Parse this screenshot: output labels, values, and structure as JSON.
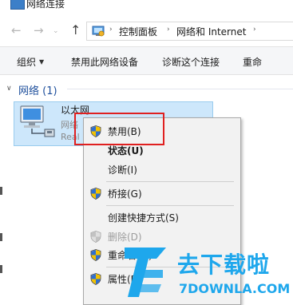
{
  "window": {
    "title": "网络连接"
  },
  "nav": {
    "back_label": "←",
    "forward_label": "→",
    "dropdown_label": "⌄",
    "up_label": "↑"
  },
  "address": {
    "crumbs": [
      "控制面板",
      "网络和 Internet"
    ],
    "separator": "›"
  },
  "toolbar": {
    "organize_label": "组织",
    "organize_caret": "▼",
    "disable_device_label": "禁用此网络设备",
    "diagnose_label": "诊断这个连接",
    "rename_label": "重命"
  },
  "group": {
    "caret": "∨",
    "title": "网络 (1)"
  },
  "adapter": {
    "name": "以太网",
    "line2": "网络",
    "line3": "Real"
  },
  "context_menu": {
    "items": [
      {
        "label": "禁用(B)",
        "shield": true,
        "bold": false,
        "disabled": false
      },
      {
        "label": "状态(U)",
        "shield": false,
        "bold": true,
        "disabled": false
      },
      {
        "label": "诊断(I)",
        "shield": false,
        "bold": false,
        "disabled": false
      },
      {
        "label": "桥接(G)",
        "shield": true,
        "bold": false,
        "disabled": false
      },
      {
        "label": "创建快捷方式(S)",
        "shield": false,
        "bold": false,
        "disabled": false
      },
      {
        "label": "删除(D)",
        "shield": true,
        "bold": false,
        "disabled": true
      },
      {
        "label": "重命名(M)",
        "shield": true,
        "bold": false,
        "disabled": false
      },
      {
        "label": "属性(R)",
        "shield": true,
        "bold": false,
        "disabled": false
      }
    ]
  },
  "watermark": {
    "cn": "去下载啦",
    "en": "7DOWNLA.COM"
  },
  "colors": {
    "highlight": "#e02020",
    "selection": "#cde7fb",
    "group_title": "#1e4f9c",
    "watermark": "#1ea7ec"
  }
}
